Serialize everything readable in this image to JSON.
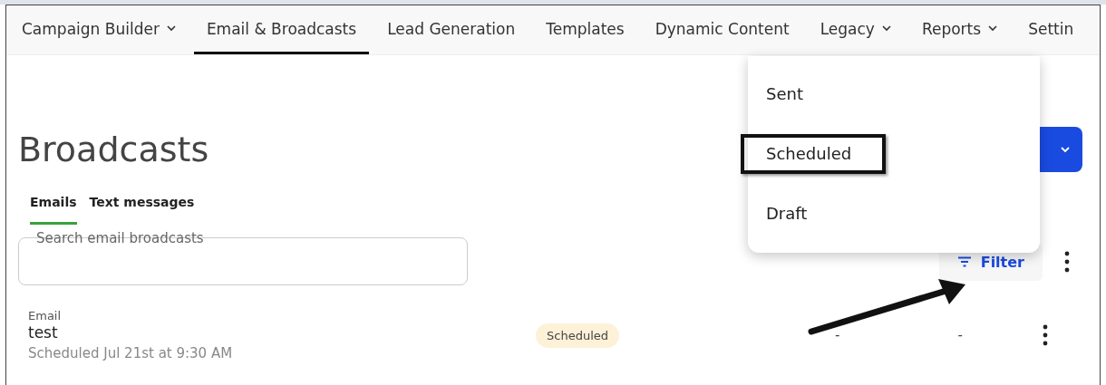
{
  "nav": {
    "tabs": [
      {
        "label": "Campaign Builder",
        "dropdown": true,
        "selected": false
      },
      {
        "label": "Email & Broadcasts",
        "dropdown": false,
        "selected": true
      },
      {
        "label": "Lead Generation",
        "dropdown": false,
        "selected": false
      },
      {
        "label": "Templates",
        "dropdown": false,
        "selected": false
      },
      {
        "label": "Dynamic Content",
        "dropdown": false,
        "selected": false
      },
      {
        "label": "Legacy",
        "dropdown": true,
        "selected": false
      },
      {
        "label": "Reports",
        "dropdown": true,
        "selected": false
      },
      {
        "label": "Settin",
        "dropdown": false,
        "selected": false
      }
    ]
  },
  "page": {
    "title": "Broadcasts",
    "tabs": [
      {
        "label": "Emails",
        "selected": true
      },
      {
        "label": "Text messages",
        "selected": false
      }
    ],
    "search": {
      "placeholder": "Search email broadcasts"
    },
    "filter": {
      "label": "Filter"
    },
    "rows": [
      {
        "type": "Email",
        "name": "test",
        "detail": "Scheduled Jul 21st at 9:30 AM",
        "status": "Scheduled",
        "column_4": "-",
        "column_5": "-"
      }
    ]
  },
  "filter_menu": {
    "items": [
      {
        "label": "Sent",
        "highlighted": false
      },
      {
        "label": "Scheduled",
        "highlighted": true
      },
      {
        "label": "Draft",
        "highlighted": false
      }
    ]
  }
}
